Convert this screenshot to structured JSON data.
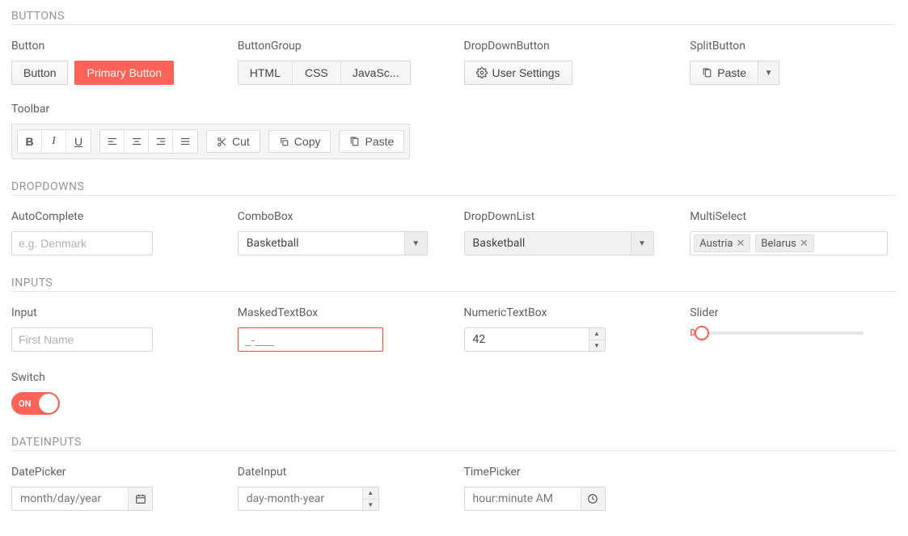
{
  "sections": {
    "buttons": "BUTTONS",
    "dropdowns": "DROPDOWNS",
    "inputs": "INPUTS",
    "dateinputs": "DATEINPUTS"
  },
  "buttons": {
    "button_label": "Button",
    "button": "Button",
    "primary": "Primary Button",
    "group_label": "ButtonGroup",
    "group": [
      "HTML",
      "CSS",
      "JavaSc..."
    ],
    "ddbutton_label": "DropDownButton",
    "ddbutton": "User Settings",
    "split_label": "SplitButton",
    "split": "Paste",
    "toolbar_label": "Toolbar",
    "toolbar": {
      "cut": "Cut",
      "copy": "Copy",
      "paste": "Paste"
    }
  },
  "dropdowns": {
    "auto_label": "AutoComplete",
    "auto_placeholder": "e.g. Denmark",
    "combo_label": "ComboBox",
    "combo_value": "Basketball",
    "list_label": "DropDownList",
    "list_value": "Basketball",
    "multi_label": "MultiSelect",
    "multi_values": [
      "Austria",
      "Belarus"
    ]
  },
  "inputs": {
    "input_label": "Input",
    "input_placeholder": "First Name",
    "mask_label": "MaskedTextBox",
    "mask_value": "_-___",
    "numeric_label": "NumericTextBox",
    "numeric_value": "42",
    "slider_label": "Slider",
    "switch_label": "Switch",
    "switch_state": "ON"
  },
  "dates": {
    "picker_label": "DatePicker",
    "picker_value": "month/day/year",
    "input_label": "DateInput",
    "input_value": "day-month-year",
    "time_label": "TimePicker",
    "time_value": "hour:minute AM"
  }
}
